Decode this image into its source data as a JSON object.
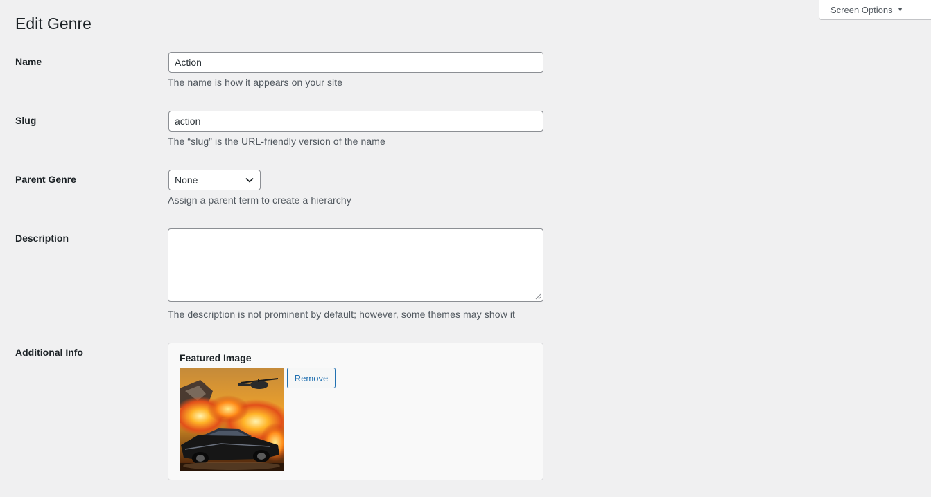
{
  "header": {
    "screen_options_label": "Screen Options",
    "title": "Edit Genre"
  },
  "form": {
    "name": {
      "label": "Name",
      "value": "Action",
      "help": "The name is how it appears on your site"
    },
    "slug": {
      "label": "Slug",
      "value": "action",
      "help": "The “slug” is the URL-friendly version of the name"
    },
    "parent": {
      "label": "Parent Genre",
      "selected": "None",
      "help": "Assign a parent term to create a hierarchy"
    },
    "description": {
      "label": "Description",
      "value": "",
      "help": "The description is not prominent by default; however, some themes may show it"
    },
    "additional_info": {
      "label": "Additional Info",
      "featured_image_label": "Featured Image",
      "remove_label": "Remove"
    }
  },
  "colors": {
    "background": "#f0f0f1",
    "accent": "#2271b1",
    "input_border": "#8c8f94",
    "help_text": "#50575e"
  }
}
